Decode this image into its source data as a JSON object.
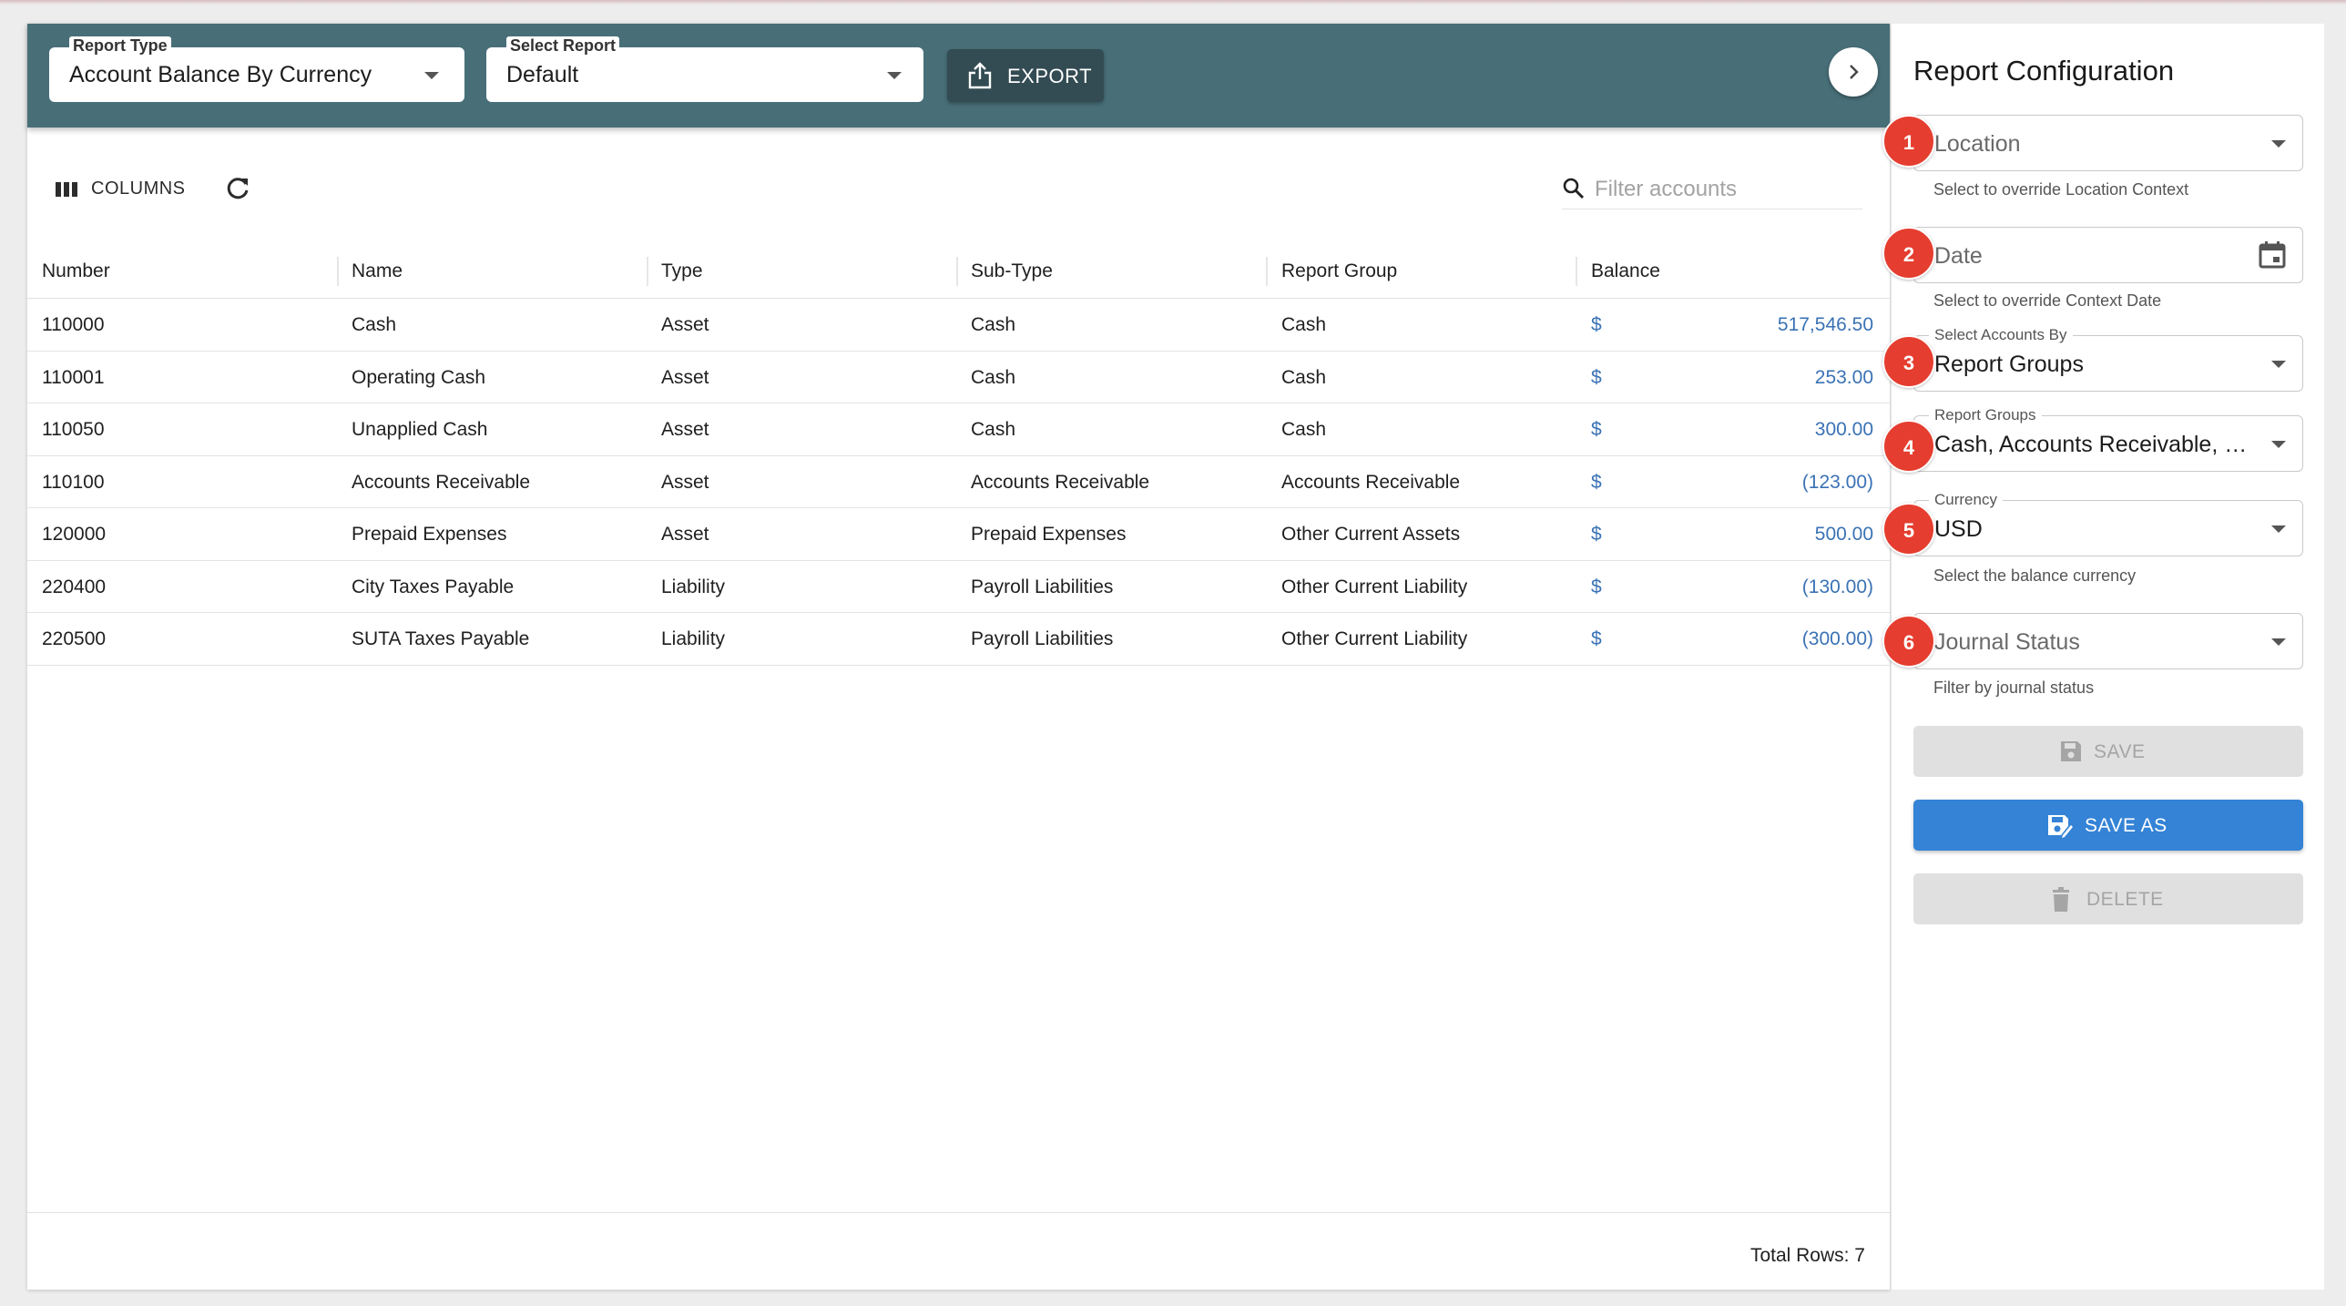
{
  "toolbar": {
    "report_type": {
      "label": "Report Type",
      "value": "Account Balance By Currency"
    },
    "select_report": {
      "label": "Select Report",
      "value": "Default"
    },
    "export_label": "EXPORT"
  },
  "grid": {
    "columns_label": "COLUMNS",
    "filter_placeholder": "Filter accounts",
    "headers": [
      "Number",
      "Name",
      "Type",
      "Sub-Type",
      "Report Group",
      "Balance"
    ],
    "rows": [
      {
        "number": "110000",
        "name": "Cash",
        "type": "Asset",
        "subtype": "Cash",
        "group": "Cash",
        "currency": "$",
        "balance": "517,546.50"
      },
      {
        "number": "110001",
        "name": "Operating Cash",
        "type": "Asset",
        "subtype": "Cash",
        "group": "Cash",
        "currency": "$",
        "balance": "253.00"
      },
      {
        "number": "110050",
        "name": "Unapplied Cash",
        "type": "Asset",
        "subtype": "Cash",
        "group": "Cash",
        "currency": "$",
        "balance": "300.00"
      },
      {
        "number": "110100",
        "name": "Accounts Receivable",
        "type": "Asset",
        "subtype": "Accounts Receivable",
        "group": "Accounts Receivable",
        "currency": "$",
        "balance": "(123.00)"
      },
      {
        "number": "120000",
        "name": "Prepaid Expenses",
        "type": "Asset",
        "subtype": "Prepaid Expenses",
        "group": "Other Current Assets",
        "currency": "$",
        "balance": "500.00"
      },
      {
        "number": "220400",
        "name": "City Taxes Payable",
        "type": "Liability",
        "subtype": "Payroll Liabilities",
        "group": "Other Current Liability",
        "currency": "$",
        "balance": "(130.00)"
      },
      {
        "number": "220500",
        "name": "SUTA Taxes Payable",
        "type": "Liability",
        "subtype": "Payroll Liabilities",
        "group": "Other Current Liability",
        "currency": "$",
        "balance": "(300.00)"
      }
    ],
    "footer": "Total Rows: 7"
  },
  "config": {
    "title": "Report Configuration",
    "location": {
      "badge": "1",
      "placeholder": "Location",
      "helper": "Select to override Location Context"
    },
    "date": {
      "badge": "2",
      "placeholder": "Date",
      "helper": "Select to override Context Date"
    },
    "accounts_by": {
      "badge": "3",
      "label": "Select Accounts By",
      "value": "Report Groups"
    },
    "report_groups": {
      "badge": "4",
      "label": "Report Groups",
      "value": "Cash, Accounts Receivable, Other Current Assets, Other Current Liability"
    },
    "currency": {
      "badge": "5",
      "label": "Currency",
      "value": "USD",
      "helper": "Select the balance currency"
    },
    "journal_status": {
      "badge": "6",
      "placeholder": "Journal Status",
      "helper": "Filter by journal status"
    },
    "save_label": "SAVE",
    "save_as_label": "SAVE AS",
    "delete_label": "DELETE"
  },
  "colors": {
    "toolbar_bg": "#486f78",
    "export_bg": "#334b52",
    "badge": "#e53d2f",
    "primary": "#3483d6",
    "amount": "#3a72b5"
  }
}
